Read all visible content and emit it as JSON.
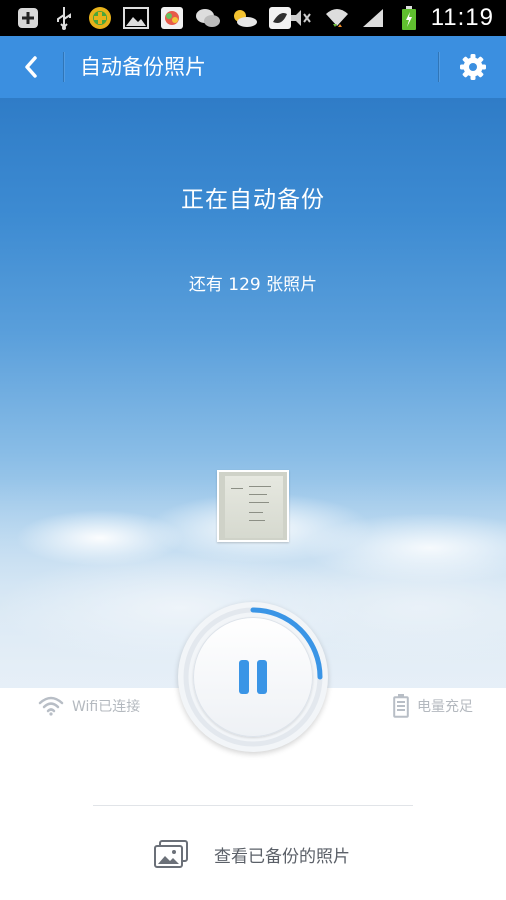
{
  "status_bar": {
    "time": "11:19",
    "icons": [
      "plus-box-icon",
      "usb-icon",
      "game-icon",
      "image-icon",
      "app-icon",
      "wechat-icon",
      "weather-icon",
      "pea-icon",
      "mute-icon",
      "wifi-icon",
      "signal-icon",
      "battery-charging-icon"
    ]
  },
  "header": {
    "title": "自动备份照片",
    "back_icon": "chevron-left-icon",
    "settings_icon": "gear-icon"
  },
  "backup": {
    "status_title": "正在自动备份",
    "remaining_text": "还有 129 张照片",
    "progress": 0.25
  },
  "info": {
    "wifi_text": "Wifi已连接",
    "battery_text": "电量充足"
  },
  "footer": {
    "view_backed_label": "查看已备份的照片",
    "view_icon": "photos-icon"
  },
  "colors": {
    "accent": "#3a95e6",
    "titlebar": "#3b8fe0",
    "muted_text": "#b4b9bf"
  }
}
